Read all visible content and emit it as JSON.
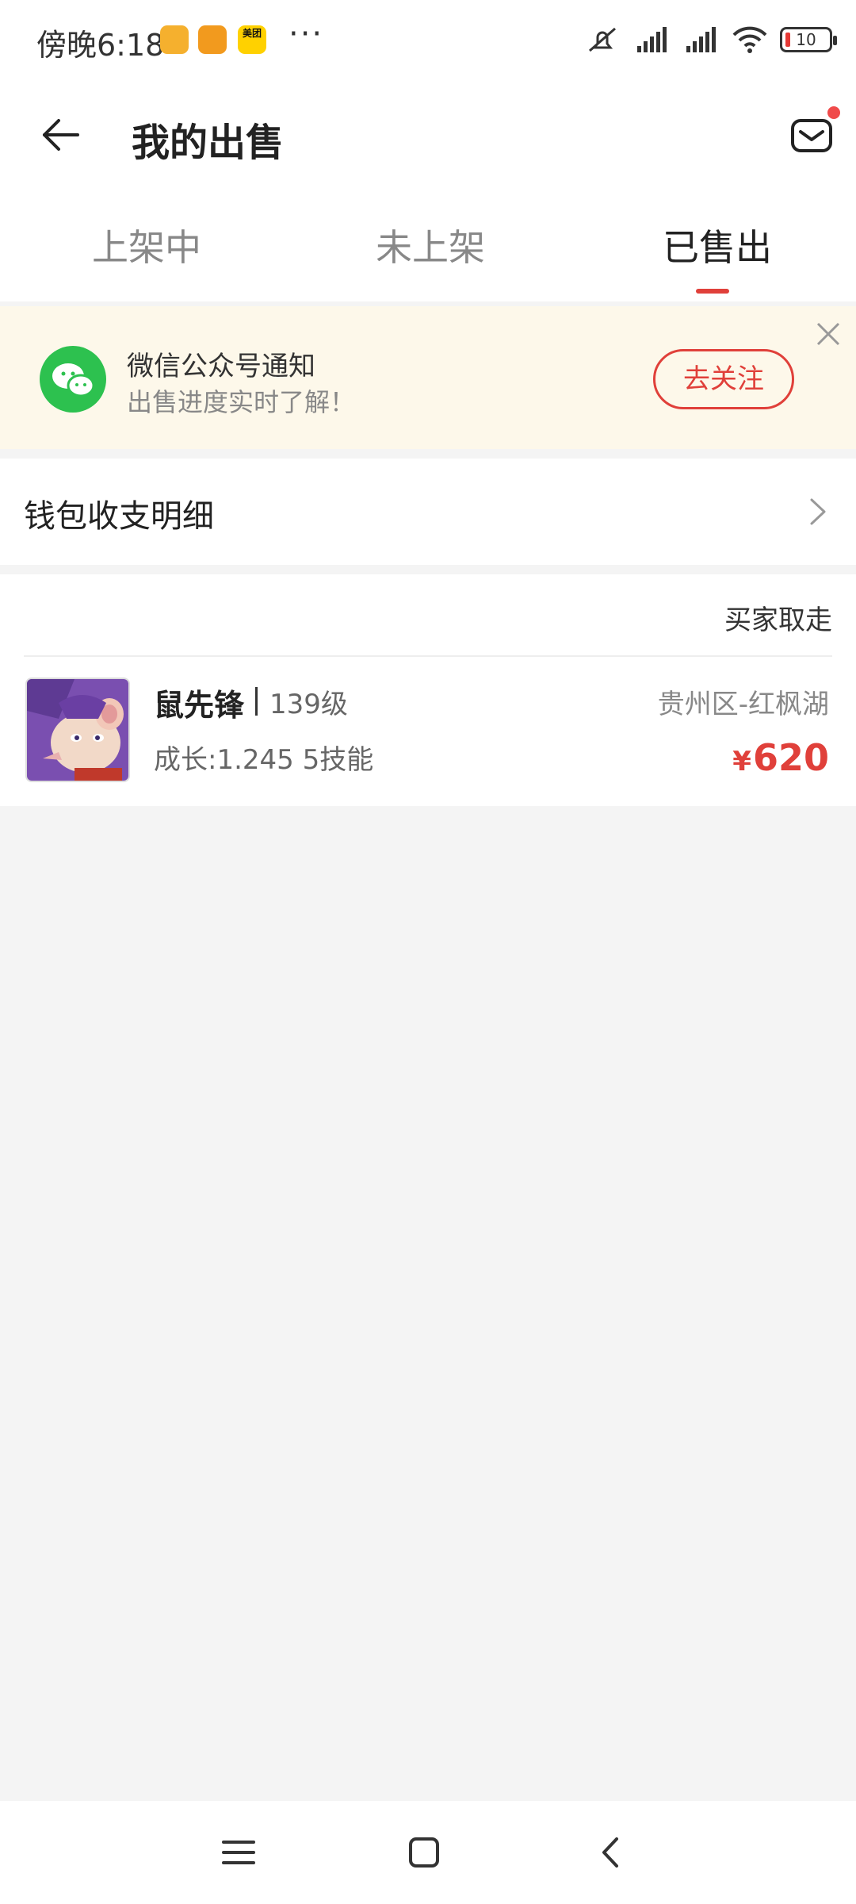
{
  "status_bar": {
    "time": "傍晚6:18",
    "app_icon_badge": "美团",
    "more": "···",
    "battery": "10"
  },
  "header": {
    "title": "我的出售"
  },
  "tabs": [
    {
      "label": "上架中",
      "active": false
    },
    {
      "label": "未上架",
      "active": false
    },
    {
      "label": "已售出",
      "active": true
    }
  ],
  "notice": {
    "title": "微信公众号通知",
    "subtitle": "出售进度实时了解！",
    "button": "去关注"
  },
  "wallet": {
    "label": "钱包收支明细"
  },
  "sold_item": {
    "status": "买家取走",
    "name": "鼠先锋",
    "level": "139级",
    "stats": "成长:1.245 5技能",
    "server": "贵州区-红枫湖",
    "currency": "¥",
    "price": "620"
  },
  "colors": {
    "accent": "#e0403a",
    "wechat_green": "#2dc14f",
    "notice_bg": "#fdf8ea",
    "page_bg": "#f4f4f4"
  }
}
